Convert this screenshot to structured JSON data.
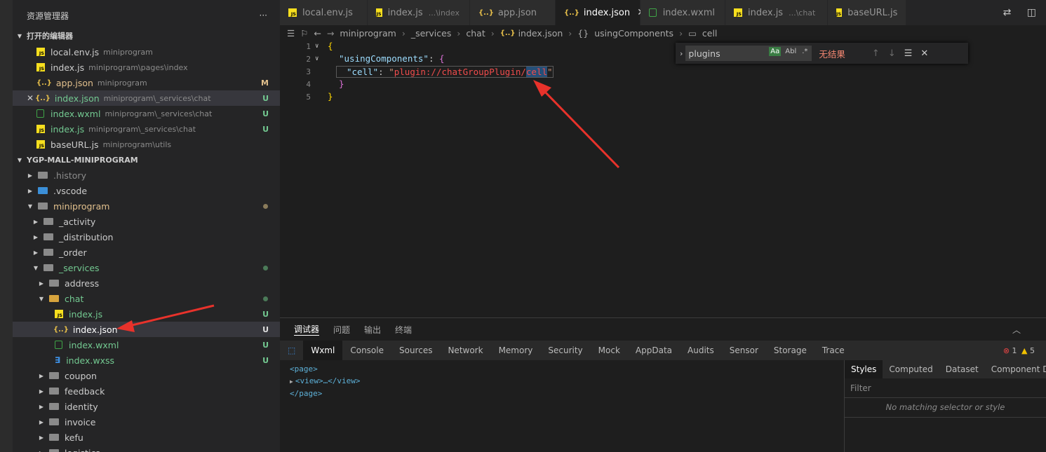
{
  "sidebar": {
    "title": "资源管理器",
    "more": "···",
    "open_editors": {
      "title": "打开的编辑器",
      "files": [
        {
          "name": "local.env.js",
          "desc": "miniprogram",
          "status": ""
        },
        {
          "name": "index.js",
          "desc": "miniprogram\\pages\\index",
          "status": ""
        },
        {
          "name": "app.json",
          "desc": "miniprogram",
          "status": "M"
        },
        {
          "name": "index.json",
          "desc": "miniprogram\\_services\\chat",
          "status": "U"
        },
        {
          "name": "index.wxml",
          "desc": "miniprogram\\_services\\chat",
          "status": "U"
        },
        {
          "name": "index.js",
          "desc": "miniprogram\\_services\\chat",
          "status": "U"
        },
        {
          "name": "baseURL.js",
          "desc": "miniprogram\\utils",
          "status": ""
        }
      ]
    },
    "project": {
      "title": "YGP-MALL-MINIPROGRAM",
      "tree": [
        ".history",
        ".vscode",
        "miniprogram",
        "_activity",
        "_distribution",
        "_order",
        "_services",
        "address",
        "chat",
        "index.js",
        "index.json",
        "index.wxml",
        "index.wxss",
        "coupon",
        "feedback",
        "identity",
        "invoice",
        "kefu",
        "logistics"
      ],
      "statuses": {
        "index.js": "U",
        "index.json": "U",
        "index.wxml": "U",
        "index.wxss": "U"
      }
    }
  },
  "tabs": [
    {
      "name": "local.env.js",
      "desc": ""
    },
    {
      "name": "index.js",
      "desc": "...\\index"
    },
    {
      "name": "app.json",
      "desc": ""
    },
    {
      "name": "index.json",
      "desc": "",
      "close": "✕"
    },
    {
      "name": "index.wxml",
      "desc": ""
    },
    {
      "name": "index.js",
      "desc": "...\\chat"
    },
    {
      "name": "baseURL.js",
      "desc": ""
    }
  ],
  "breadcrumb": [
    "miniprogram",
    "_services",
    "chat",
    "index.json",
    "usingComponents",
    "cell"
  ],
  "editor": {
    "line_numbers": [
      "1",
      "2",
      "3",
      "4",
      "5"
    ],
    "l1": "{",
    "l2_key": "\"usingComponents\"",
    "l2_colon": ": ",
    "l2_brace": "{",
    "l3_key": "\"cell\"",
    "l3_colon": ": ",
    "l3_q1": "\"",
    "l3_value": "plugin://chatGroupPlugin/",
    "l3_match": "cell",
    "l3_q2": "\"",
    "l4": "}",
    "l5": "}"
  },
  "find": {
    "value": "plugins",
    "opt_case": "Aa",
    "opt_word": "Abl",
    "opt_regex": ".*",
    "result": "无结果"
  },
  "panel": {
    "tabs": [
      "调试器",
      "问题",
      "输出",
      "终端"
    ],
    "devtools_tabs": [
      "Wxml",
      "Console",
      "Sources",
      "Network",
      "Memory",
      "Security",
      "Mock",
      "AppData",
      "Audits",
      "Sensor",
      "Storage",
      "Trace"
    ],
    "errors": "1",
    "warnings": "5",
    "wxml": {
      "l1": "<page>",
      "l2": "<view>…</view>",
      "l3": "</page>"
    },
    "style_tabs": [
      "Styles",
      "Computed",
      "Dataset",
      "Component Data"
    ],
    "filter_placeholder": "Filter",
    "no_match": "No matching selector or style"
  },
  "colors": {
    "arrow": "#e8322b",
    "accent_green": "#73c991",
    "modified": "#e2c08d"
  }
}
